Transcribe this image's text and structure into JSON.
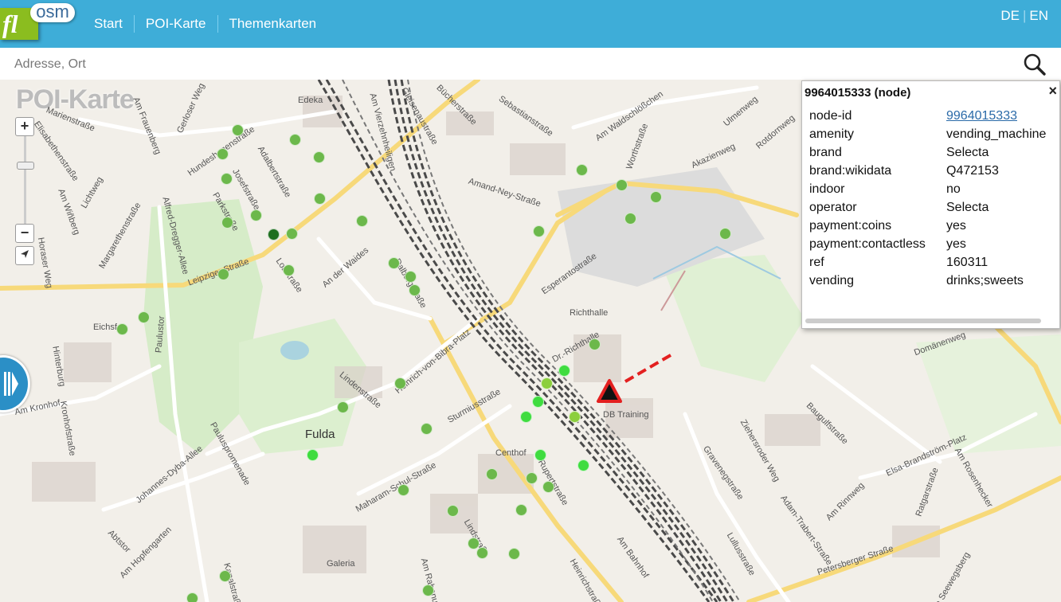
{
  "header": {
    "logo_fl": "fl",
    "logo_osm": "osm",
    "nav": [
      "Start",
      "POI-Karte",
      "Themenkarten"
    ],
    "lang": {
      "de": "DE",
      "sep": "|",
      "en": "EN"
    }
  },
  "search": {
    "placeholder": "Adresse, Ort",
    "icon": "search-icon"
  },
  "map": {
    "title": "POI-Karte",
    "zoom_in": "+",
    "zoom_out": "−",
    "city": "Fulda",
    "labels": [
      "Edeka",
      "Richthalle",
      "DB Training",
      "Centhof",
      "Galeria",
      "Eichsf",
      "Marienstraße",
      "Elisabethenstraße",
      "Am Frauenberg",
      "Gerloser Weg",
      "Hundeshagenstraße",
      "Adalbertstraße",
      "Josefstraße",
      "Parkstraße",
      "Lichtweg",
      "Am Wiñberg",
      "Margarethenstraße",
      "Alfred-Dregger-Allee",
      "Horaser Weg",
      "Leipziger Straße",
      "Lobstraße",
      "An der Waides",
      "Am Vierzehnheiligen",
      "Gleisenaustraße",
      "Bücherstraße",
      "Sebastianstraße",
      "Am Waldschlößchen",
      "Ulmenweg",
      "Rotdornweg",
      "Akazienweg",
      "Worthstraße",
      "Amand-Ney-Straße",
      "Esperantostraße",
      "Dalbergstraße",
      "Heinrich-von-Bibra-Platz",
      "Lindenstraße",
      "Sturmiusstraße",
      "Paulustor",
      "Hinterburg",
      "Am Kronhof",
      "Kronhofstraße",
      "Johannes-Dyba-Allee",
      "Pauluspromenade",
      "Maharam-Schul-Straße",
      "Abtstor",
      "Am Hopfengarten",
      "Rupertstraße",
      "Lindstraße",
      "Am Bahnhof",
      "Heinrichstraße",
      "Gravenegstraße",
      "Adam-Trabert-Straße",
      "Lullusstraße",
      "Ziehersroder Weg",
      "Baugulfstraße",
      "Elsa-Brandström-Platz",
      "Am Rinnweg",
      "Ratgarstraße",
      "Am Rosenhecker",
      "Petersberger Straße",
      "Domänenweg",
      "Am Seewegsberg",
      "Am Rabanus",
      "Kanalstraße",
      "Dr.-Richthalle"
    ],
    "poi_count": 56
  },
  "popup": {
    "title": "9964015333 (node)",
    "close": "×",
    "rows": [
      {
        "k": "node-id",
        "v": "9964015333",
        "link": true
      },
      {
        "k": "amenity",
        "v": "vending_machine"
      },
      {
        "k": "brand",
        "v": "Selecta"
      },
      {
        "k": "brand:wikidata",
        "v": "Q472153"
      },
      {
        "k": "indoor",
        "v": "no"
      },
      {
        "k": "operator",
        "v": "Selecta"
      },
      {
        "k": "payment:coins",
        "v": "yes"
      },
      {
        "k": "payment:contactless",
        "v": "yes"
      },
      {
        "k": "ref",
        "v": "160311"
      },
      {
        "k": "vending",
        "v": "drinks;sweets"
      }
    ]
  },
  "colors": {
    "header": "#3eadd8",
    "logo_green": "#8bbd1f",
    "marker_red": "#e32020",
    "poi_green": "#6cb84b"
  }
}
